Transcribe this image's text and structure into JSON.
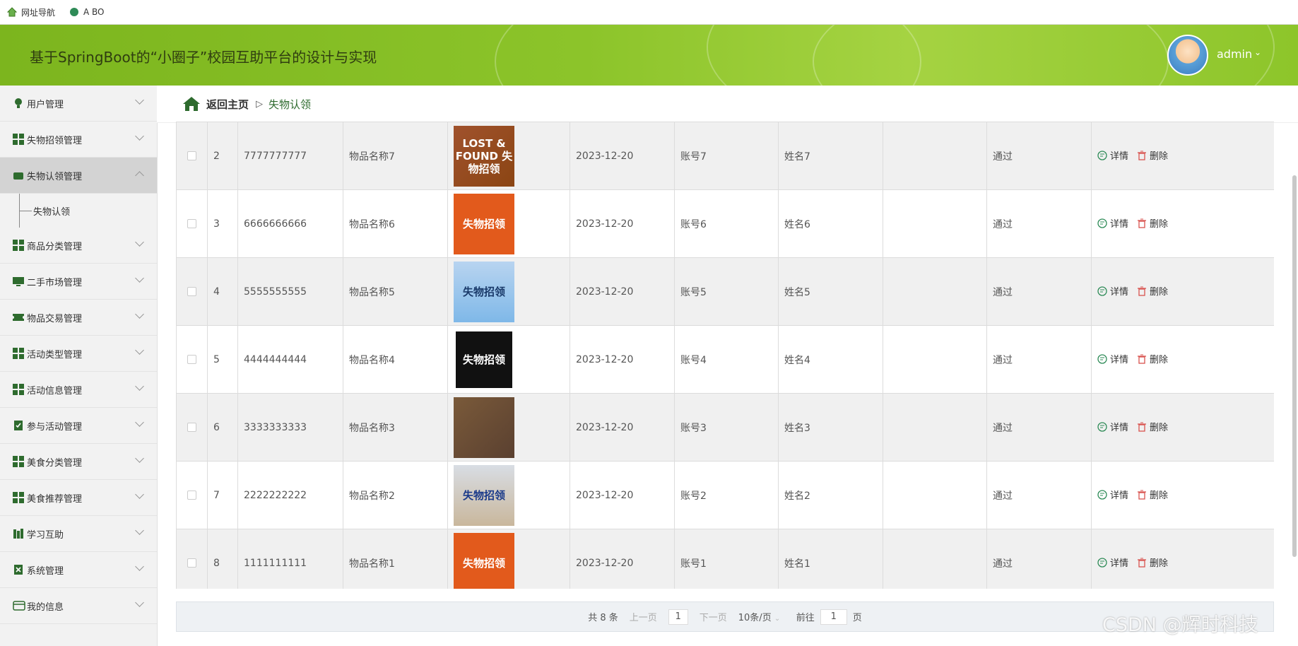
{
  "bookmarks": [
    {
      "label": "网址导航",
      "icon": "home-bookmark-icon"
    },
    {
      "label": "A BO",
      "icon": "leaf-bookmark-icon"
    }
  ],
  "header": {
    "title": "基于SpringBoot的“小圈子”校园互助平台的设计与实现",
    "user": "admin",
    "accent": "#8cc42a"
  },
  "sidebar": {
    "items": [
      {
        "label": "用户管理",
        "icon": "bulb-icon"
      },
      {
        "label": "失物招领管理",
        "icon": "grid-icon"
      },
      {
        "label": "失物认领管理",
        "icon": "wallet-icon",
        "active": true
      },
      {
        "label": "商品分类管理",
        "icon": "grid-icon"
      },
      {
        "label": "二手市场管理",
        "icon": "monitor-icon"
      },
      {
        "label": "物品交易管理",
        "icon": "ticket-icon"
      },
      {
        "label": "活动类型管理",
        "icon": "grid-icon"
      },
      {
        "label": "活动信息管理",
        "icon": "grid-icon"
      },
      {
        "label": "参与活动管理",
        "icon": "clipboard-check-icon"
      },
      {
        "label": "美食分类管理",
        "icon": "grid-icon"
      },
      {
        "label": "美食推荐管理",
        "icon": "grid-icon"
      },
      {
        "label": "学习互助",
        "icon": "books-icon"
      },
      {
        "label": "系统管理",
        "icon": "clipboard-x-icon"
      },
      {
        "label": "我的信息",
        "icon": "card-icon"
      }
    ],
    "submenu": {
      "label": "失物认领"
    }
  },
  "breadcrumb": {
    "home": "返回主页",
    "separator": "▷",
    "current": "失物认领"
  },
  "table": {
    "rows": [
      {
        "index": "2",
        "code": "7777777777",
        "name": "物品名称7",
        "image_text": "LOST & FOUND 失物招领",
        "date": "2023-12-20",
        "account": "账号7",
        "person": "姓名7",
        "extra": "",
        "status": "通过"
      },
      {
        "index": "3",
        "code": "6666666666",
        "name": "物品名称6",
        "image_text": "失物招领",
        "date": "2023-12-20",
        "account": "账号6",
        "person": "姓名6",
        "extra": "",
        "status": "通过"
      },
      {
        "index": "4",
        "code": "5555555555",
        "name": "物品名称5",
        "image_text": "失物招领",
        "date": "2023-12-20",
        "account": "账号5",
        "person": "姓名5",
        "extra": "",
        "status": "通过"
      },
      {
        "index": "5",
        "code": "4444444444",
        "name": "物品名称4",
        "image_text": "失物招领",
        "date": "2023-12-20",
        "account": "账号4",
        "person": "姓名4",
        "extra": "",
        "status": "通过"
      },
      {
        "index": "6",
        "code": "3333333333",
        "name": "物品名称3",
        "image_text": "",
        "date": "2023-12-20",
        "account": "账号3",
        "person": "姓名3",
        "extra": "",
        "status": "通过"
      },
      {
        "index": "7",
        "code": "2222222222",
        "name": "物品名称2",
        "image_text": "失物招领",
        "date": "2023-12-20",
        "account": "账号2",
        "person": "姓名2",
        "extra": "",
        "status": "通过"
      },
      {
        "index": "8",
        "code": "1111111111",
        "name": "物品名称1",
        "image_text": "失物招领",
        "date": "2023-12-20",
        "account": "账号1",
        "person": "姓名1",
        "extra": "",
        "status": "通过"
      }
    ],
    "detail_label": "详情",
    "delete_label": "删除"
  },
  "pager": {
    "total": "共 8 条",
    "prev": "上一页",
    "page": "1",
    "next": "下一页",
    "size": "10条/页",
    "goto_label": "前往",
    "goto_value": "1",
    "goto_unit": "页"
  },
  "watermark": "CSDN @辉时科技"
}
